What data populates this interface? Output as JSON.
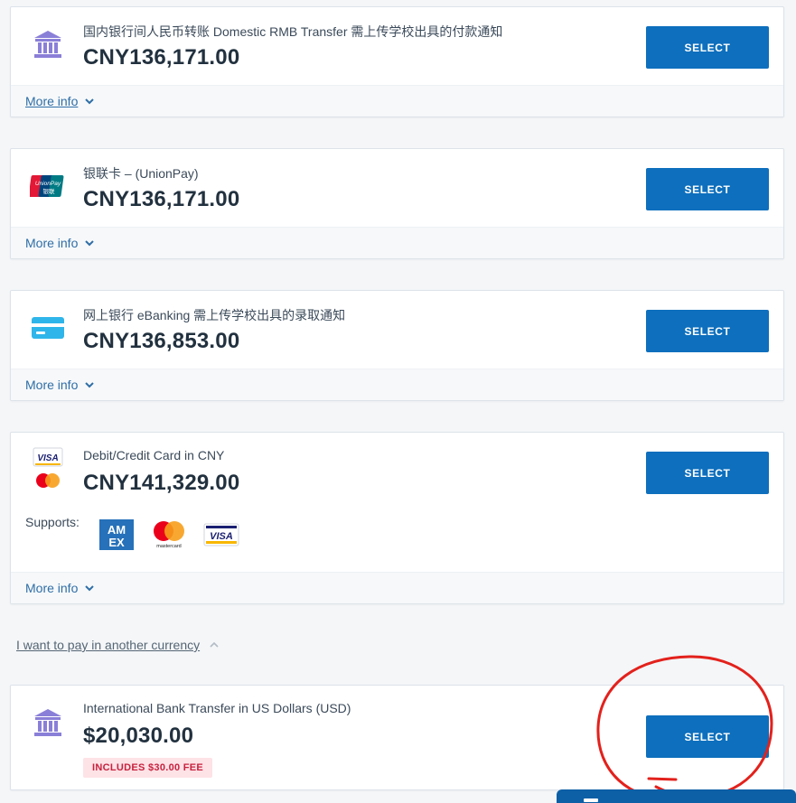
{
  "options": [
    {
      "id": "domestic-rmb",
      "label": "国内银行间人民币转账 Domestic RMB Transfer 需上传学校出具的付款通知",
      "amount": "CNY136,171.00",
      "select_label": "SELECT",
      "more_label": "More info",
      "icon": "bank-icon"
    },
    {
      "id": "unionpay",
      "label": "银联卡 – (UnionPay)",
      "amount": "CNY136,171.00",
      "select_label": "SELECT",
      "more_label": "More info",
      "icon": "unionpay-icon",
      "icon_text": [
        "UnionPay",
        "银联"
      ]
    },
    {
      "id": "ebanking",
      "label": "网上银行 eBanking 需上传学校出具的录取通知",
      "amount": "CNY136,853.00",
      "select_label": "SELECT",
      "more_label": "More info",
      "icon": "card-icon"
    },
    {
      "id": "card-cny",
      "label": "Debit/Credit Card in CNY",
      "amount": "CNY141,329.00",
      "select_label": "SELECT",
      "more_label": "More info",
      "icon": "visa-mastercard-icon",
      "supports_label": "Supports:",
      "supported_brands": [
        "amex-icon",
        "mastercard-icon",
        "visa-icon"
      ],
      "brand_text": {
        "visa": "VISA",
        "amex": [
          "AM",
          "EX"
        ],
        "mastercard": "mastercard"
      }
    },
    {
      "id": "intl-usd",
      "label": "International Bank Transfer in US Dollars (USD)",
      "amount": "$20,030.00",
      "select_label": "SELECT",
      "fee_badge": "INCLUDES $30.00 FEE",
      "icon": "bank-icon"
    }
  ],
  "another_currency_label": "I want to pay in another currency",
  "colors": {
    "select_button": "#0d6fbd",
    "bank_icon": "#8a7fd8",
    "fee_badge_bg": "#fde2e6",
    "fee_badge_text": "#c8223f",
    "annotation": "#e3211c"
  }
}
